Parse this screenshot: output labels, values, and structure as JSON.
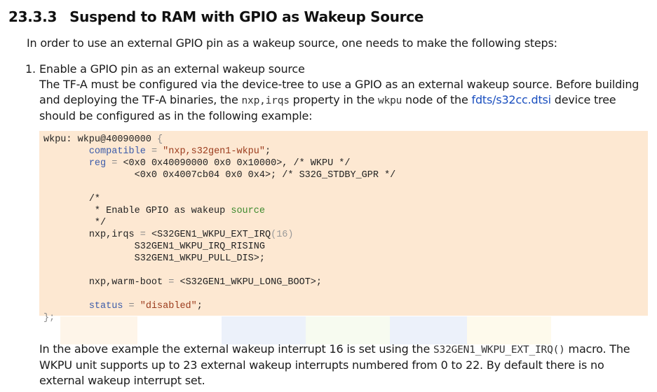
{
  "heading": {
    "number": "23.3.3",
    "title": "Suspend to RAM with GPIO as Wakeup Source"
  },
  "intro": "In order to use an external GPIO pin as a wakeup source, one needs to make the following steps:",
  "step1": {
    "marker": "1.",
    "title": "Enable a GPIO pin as an external wakeup source",
    "text_a": "The TF-A must be configured via the device-tree to use a GPIO as an external wakeup source. Before building and deploying the TF-A binaries, the ",
    "code_a": "nxp,irqs",
    "text_b": " property in the ",
    "code_b": "wkpu",
    "text_c": " node of the ",
    "link": "fdts/s32cc.dtsi",
    "text_d": " device tree should be configured as in the following example:"
  },
  "code": {
    "l1a": "wkpu: wkpu@40090000 ",
    "l1b": "{",
    "compatible_key": "compatible",
    "compatible_val": "\"nxp,s32gen1-wkpu\"",
    "reg_key": "reg",
    "reg_val": "<0x0 0x40090000 0x0 0x10000>, /* WKPU */",
    "reg_val2": "<0x0 0x4007cb04 0x0 0x4>; /* S32G_STDBY_GPR */",
    "comment_open": "/*",
    "comment_mid": "* Enable GPIO as wakeup ",
    "comment_kw": "source",
    "comment_close": "*/",
    "irqs_key": "nxp,irqs",
    "irqs_val_a": "<S32GEN1_WKPU_EXT_IRQ",
    "irqs_num": "(16)",
    "irqs_val2": "S32GEN1_WKPU_IRQ_RISING",
    "irqs_val3": "S32GEN1_WKPU_PULL_DIS>;",
    "warm_key": "nxp,warm-boot",
    "warm_val": "<S32GEN1_WKPU_LONG_BOOT>;",
    "status_key": "status",
    "status_val": "\"disabled\"",
    "eq": "=",
    "semi": ";",
    "end": "};"
  },
  "after": {
    "text_a": "In the above example the external wakeup interrupt 16 is set using the ",
    "code": "S32GEN1_WKPU_EXT_IRQ()",
    "text_b": " macro. The WKPU unit supports up to 23 external wakeup interrupts numbered from 0 to 22. By default there is no external wakeup interrupt set."
  }
}
